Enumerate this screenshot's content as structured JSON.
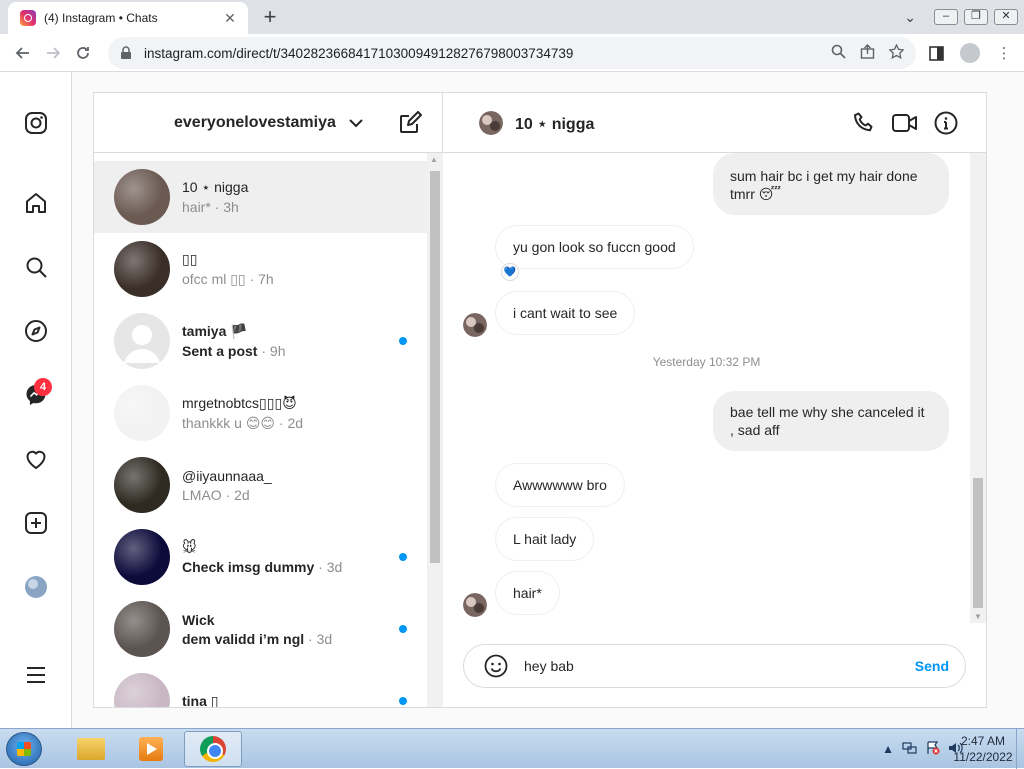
{
  "browser": {
    "tab_title": "(4) Instagram • Chats",
    "url": "instagram.com/direct/t/340282366841710300949128276798003734739"
  },
  "sidebar": {
    "messages_badge": "4"
  },
  "inbox": {
    "account_name": "everyonelovestamiya",
    "threads": [
      {
        "name": "10 ⋆ nigga",
        "preview": "hair*",
        "time": "3h",
        "unread": false,
        "active": true,
        "avatar_color": "#6b5a52"
      },
      {
        "name": "▯▯",
        "preview": "ofcc ml ▯▯",
        "time": "7h",
        "unread": false,
        "active": false,
        "avatar_color": "#3a2e28"
      },
      {
        "name": "tamiya 🏴",
        "preview": "Sent a post",
        "time": "9h",
        "unread": true,
        "active": false,
        "avatar_color": "#e6e6e6"
      },
      {
        "name": "mrgetnobtcs▯▯▯😈",
        "preview": "thankkk u 😊😊",
        "time": "2d",
        "unread": false,
        "active": false,
        "avatar_color": "#f2f2f2"
      },
      {
        "name": "@iiyaunnaaa_",
        "preview": "LMAO",
        "time": "2d",
        "unread": false,
        "active": false,
        "avatar_color": "#2e2a22"
      },
      {
        "name": "🐭",
        "preview": "Check imsg dummy",
        "time": "3d",
        "unread": true,
        "active": false,
        "avatar_color": "#0d0b3a"
      },
      {
        "name": "Wick",
        "preview": "dem validd i’m ngl",
        "time": "3d",
        "unread": true,
        "active": false,
        "avatar_color": "#5c5450"
      },
      {
        "name": "tina ▯",
        "preview": "",
        "time": "",
        "unread": true,
        "active": false,
        "avatar_color": "#c9b8c4"
      }
    ]
  },
  "chat": {
    "title": "10 ⋆ nigga",
    "messages": [
      {
        "text": "sum hair bc i get my hair done tmrr 😴",
        "dir": "sent"
      },
      {
        "text": "yu gon look so fuccn good",
        "dir": "recv"
      },
      {
        "text": "i cant wait to see",
        "dir": "recv"
      },
      {
        "text": "bae tell me why she canceled it , sad aff",
        "dir": "sent"
      },
      {
        "text": "Awwwwww bro",
        "dir": "recv"
      },
      {
        "text": "L hait lady",
        "dir": "recv"
      },
      {
        "text": "hair*",
        "dir": "recv"
      }
    ],
    "reaction": "💙",
    "timestamp": "Yesterday 10:32 PM",
    "input_value": "hey bab",
    "send_label": "Send"
  },
  "taskbar": {
    "time": "2:47 AM",
    "date": "11/22/2022"
  },
  "colors": {
    "instagram_blue": "#0095f6",
    "badge_red": "#ff3040"
  }
}
